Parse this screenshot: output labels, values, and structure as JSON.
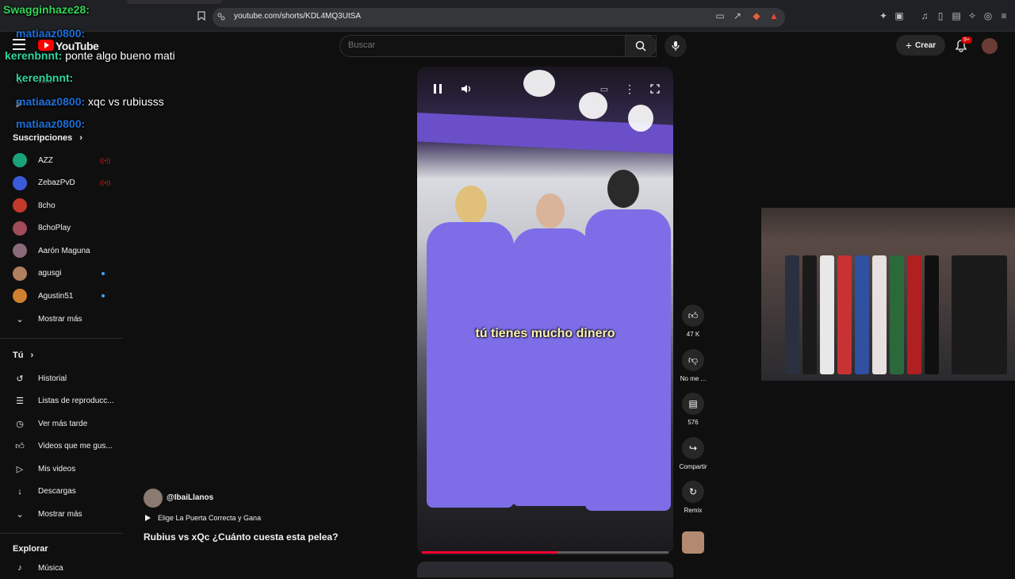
{
  "browser": {
    "url": "youtube.com/shorts/KDL4MQ3UtSA"
  },
  "header": {
    "logo_text": "YouTube",
    "search_placeholder": "Buscar",
    "create_label": "Crear",
    "notification_count": "9+"
  },
  "chat": [
    {
      "user": "Swagginhaze28:",
      "user_color": "#2fd657",
      "message": ""
    },
    {
      "user": "matiaaz0800:",
      "user_color": "#1e6fd9",
      "message": ""
    },
    {
      "user": "kerenbnnt:",
      "user_color": "#2fd6a0",
      "message": " ponte algo bueno mati"
    },
    {
      "user": "kerenbnnt:",
      "user_color": "#2fd6a0",
      "message": ""
    },
    {
      "user": "matiaaz0800:",
      "user_color": "#1e6fd9",
      "message": " xqc vs rubiusss"
    },
    {
      "user": "matiaaz0800:",
      "user_color": "#1e6fd9",
      "message": ""
    }
  ],
  "sidebar": {
    "home_partial": "Inicio",
    "shorts_partial": "Shorts",
    "subscriptions_heading": "Suscripciones",
    "subscriptions": [
      {
        "label": "AZZ",
        "live": true,
        "color": "#1aa37a"
      },
      {
        "label": "ZebazPvD",
        "live": true,
        "color": "#3a5bd9"
      },
      {
        "label": "8cho",
        "live": false,
        "color": "#c0392b"
      },
      {
        "label": "8choPlay",
        "live": false,
        "color": "#a14a5a"
      },
      {
        "label": "Aarón Maguna",
        "live": false,
        "color": "#8a6a7a"
      },
      {
        "label": "agusgi",
        "live": false,
        "dot": true,
        "color": "#b08060"
      },
      {
        "label": "Agustin51",
        "live": false,
        "dot": true,
        "color": "#d08030"
      }
    ],
    "subs_show_more": "Mostrar más",
    "you_heading": "Tú",
    "you_items": [
      {
        "label": "Historial",
        "icon": "history-icon"
      },
      {
        "label": "Listas de reproducc...",
        "icon": "playlist-icon"
      },
      {
        "label": "Ver más tarde",
        "icon": "clock-icon"
      },
      {
        "label": "Videos que me gus...",
        "icon": "thumb-up-icon"
      },
      {
        "label": "Mis videos",
        "icon": "my-videos-icon"
      },
      {
        "label": "Descargas",
        "icon": "download-icon"
      }
    ],
    "you_show_more": "Mostrar más",
    "explore_heading": "Explorar",
    "explore_items": [
      {
        "label": "Música",
        "icon": "music-icon"
      }
    ]
  },
  "short": {
    "subtitle": "tú tienes mucho dinero",
    "progress": 0.55,
    "channel": "@IbaiLlanos",
    "playlist": "Elige La Puerta Correcta y Gana",
    "title": "Rubius vs xQc ¿Cuánto cuesta esta pelea?",
    "likes": "47 K",
    "dislike_label": "No me ...",
    "comments": "576",
    "share_label": "Compartir",
    "remix_label": "Remix"
  }
}
